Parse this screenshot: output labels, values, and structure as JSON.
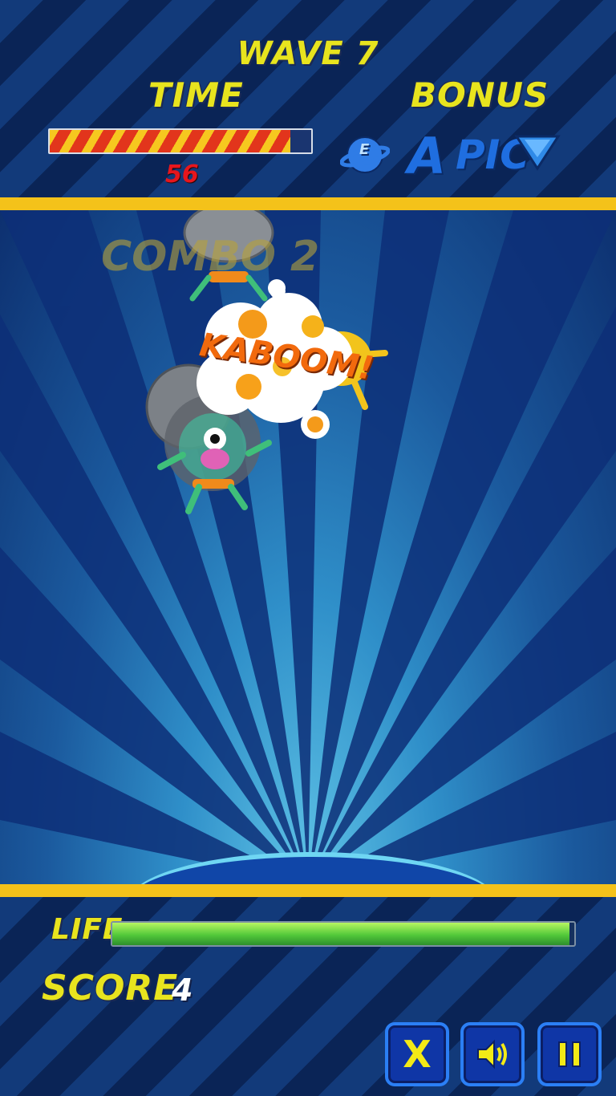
{
  "hud": {
    "wave": "WAVE 7",
    "time_label": "TIME",
    "time_value": "56",
    "time_fraction": 0.92,
    "bonus_label": "BONUS",
    "bonus_letters": [
      "A",
      "PIC"
    ],
    "bonus_icons": [
      "planet-icon",
      "arrow-down-icon"
    ]
  },
  "game": {
    "combo_text": "COMBO 2",
    "explosion_text": "KABOOM!"
  },
  "footer": {
    "life_label": "LIFE",
    "life_fraction": 0.99,
    "score_label": "SCORE",
    "score_value": "4",
    "buttons": {
      "close": "X",
      "sound_icon": "speaker-icon",
      "pause_icon": "pause-icon"
    }
  },
  "colors": {
    "accent_yellow": "#f4c21a",
    "title_text": "#e8e41e",
    "time_number": "#e6161d",
    "button_border": "#2b7ff5"
  }
}
